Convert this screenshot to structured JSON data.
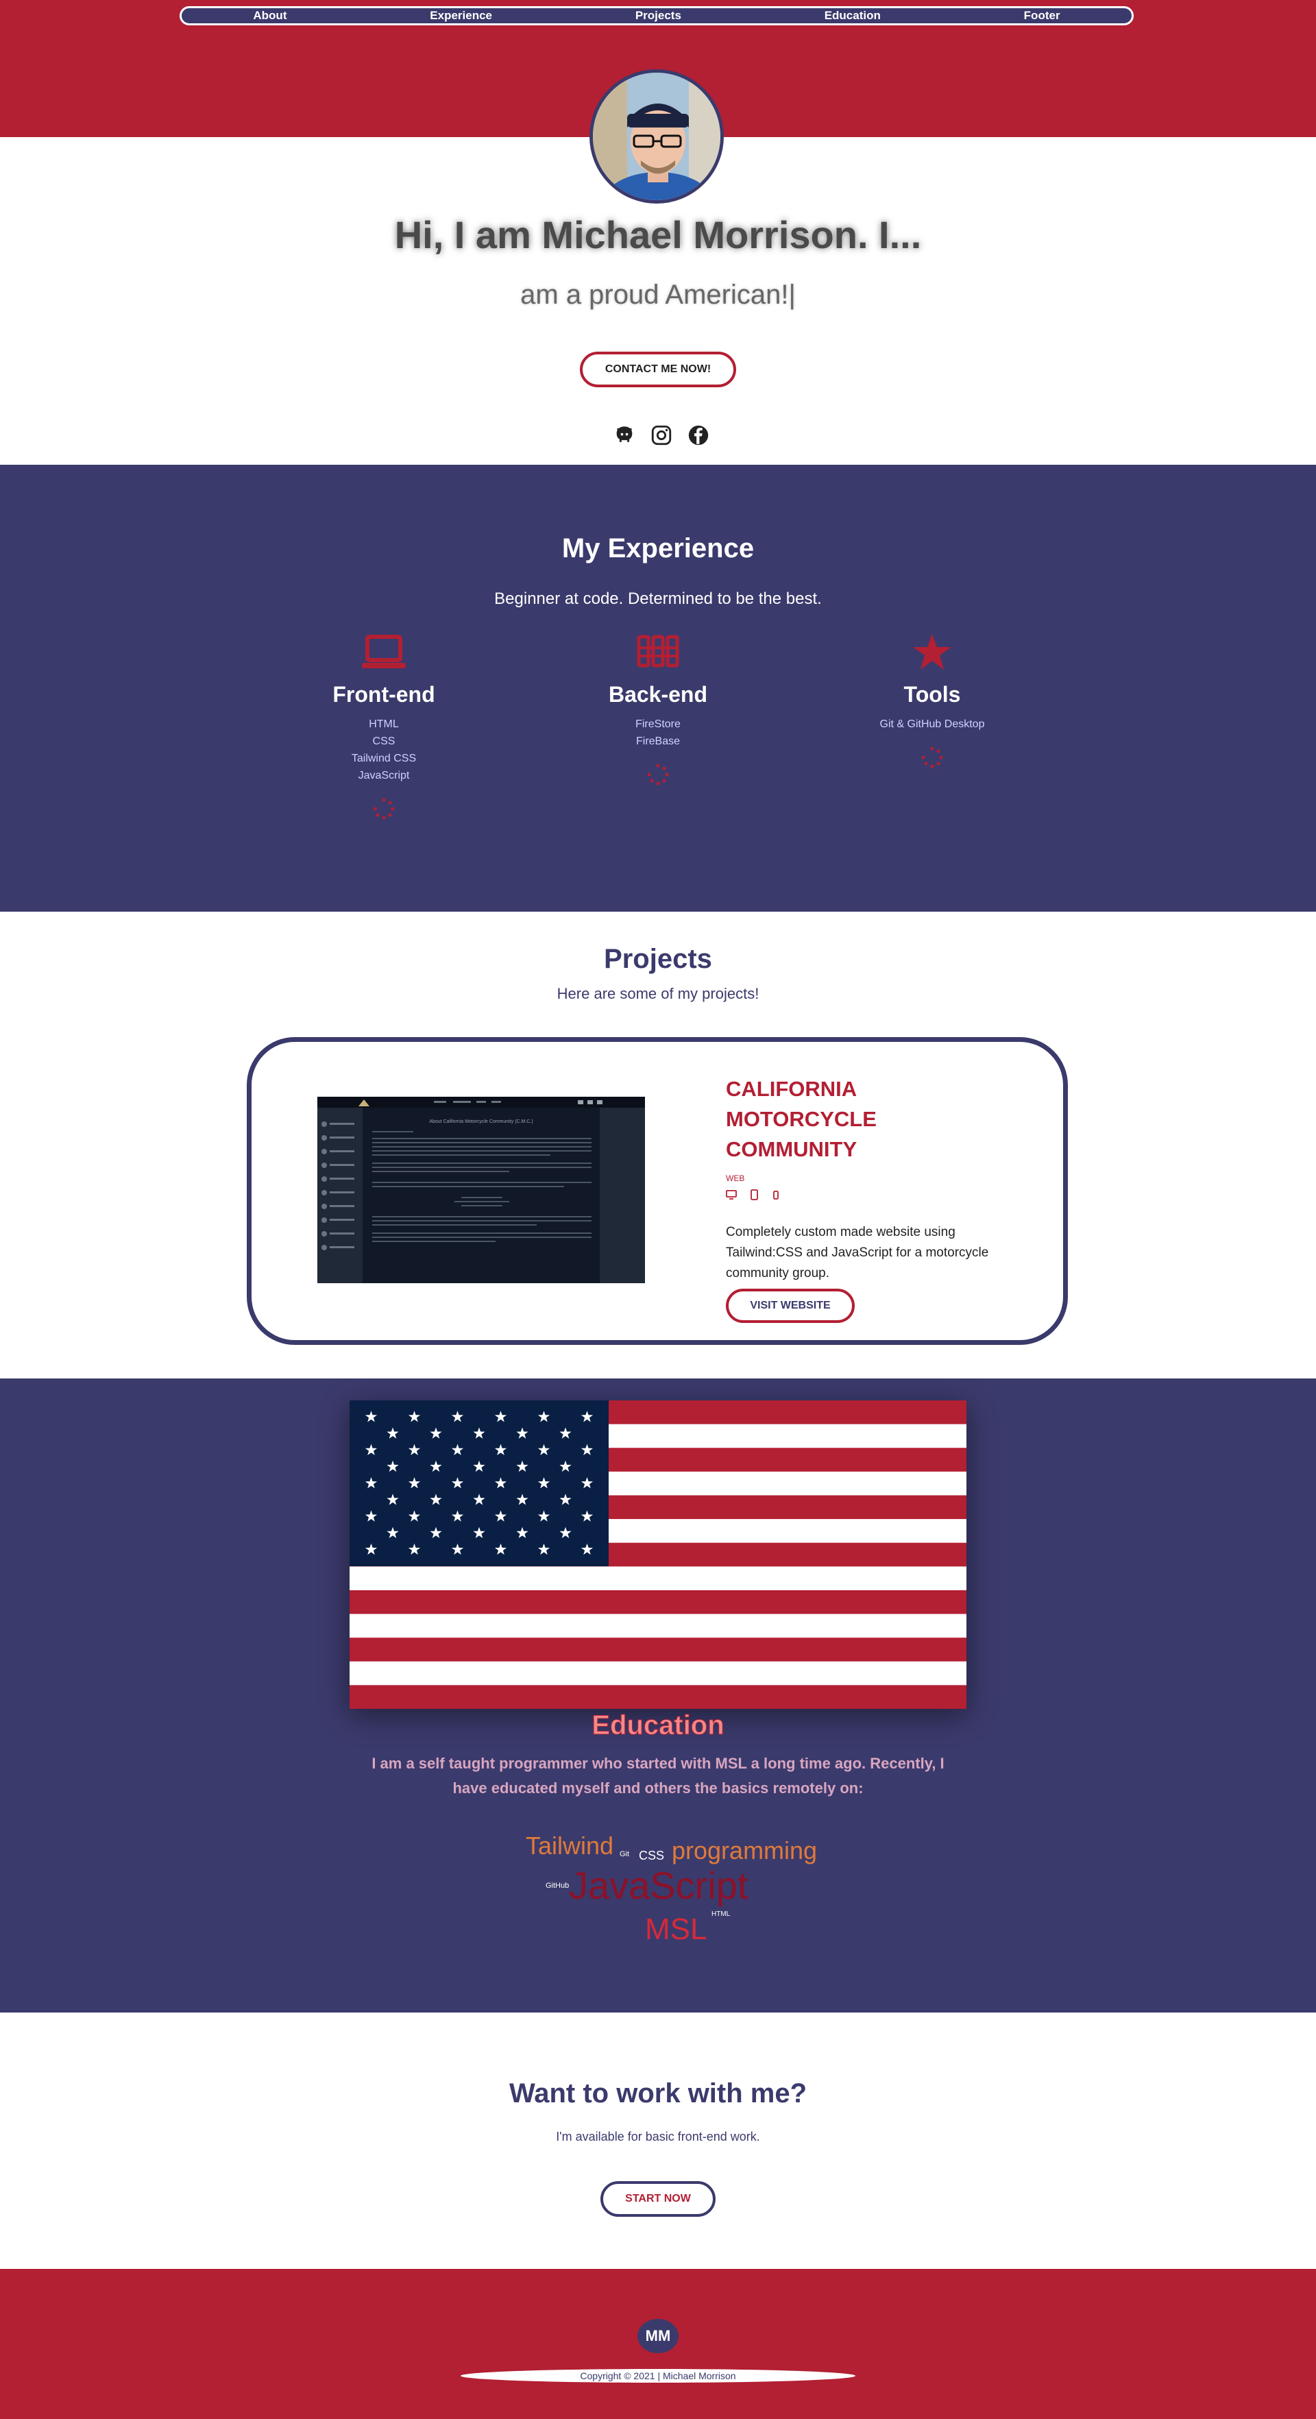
{
  "nav": {
    "items": [
      "About",
      "Experience",
      "Projects",
      "Education",
      "Footer"
    ]
  },
  "hero": {
    "title": "Hi, I am Michael Morrison. I...",
    "typed": "am a proud American!|",
    "contact_label": "CONTACT ME NOW!",
    "social": [
      "github-icon",
      "instagram-icon",
      "facebook-icon"
    ]
  },
  "experience": {
    "title": "My Experience",
    "subtitle": "Beginner at code. Determined to be the best.",
    "columns": [
      {
        "title": "Front-end",
        "icon": "laptop-icon",
        "items": [
          "HTML",
          "CSS",
          "Tailwind CSS",
          "JavaScript"
        ]
      },
      {
        "title": "Back-end",
        "icon": "server-icon",
        "items": [
          "FireStore",
          "FireBase"
        ]
      },
      {
        "title": "Tools",
        "icon": "star-icon",
        "items": [
          "Git & GitHub Desktop"
        ]
      }
    ]
  },
  "projects": {
    "title": "Projects",
    "subtitle": "Here are some of my projects!",
    "card": {
      "name": "CALIFORNIA MOTORCYCLE COMMUNITY",
      "tag": "WEB",
      "description": "Completely custom made website using Tailwind:CSS and JavaScript for a motorcycle community group.",
      "visit_label": "VISIT WEBSITE",
      "screenshot_heading": "About California Motorcycle Community (C.M.C.)"
    }
  },
  "education": {
    "title": "Education",
    "description": "I am a self taught programmer who started with MSL a long time ago. Recently, I have educated myself and others the basics remotely on:",
    "cloud": [
      "Tailwind",
      "Git",
      "CSS",
      "programming",
      "GitHub",
      "JavaScript",
      "HTML",
      "MSL"
    ]
  },
  "cta": {
    "title": "Want to work with me?",
    "subtitle": "I'm available for basic front-end work.",
    "button": "START NOW"
  },
  "footer": {
    "logo": "MM",
    "copyright": "Copyright © 2021 | Michael Morrison"
  },
  "colors": {
    "red": "#b31f33",
    "navy": "#3b3a6c",
    "white": "#ffffff"
  }
}
